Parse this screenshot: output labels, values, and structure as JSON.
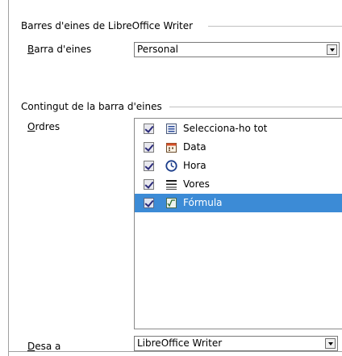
{
  "toolbars_section": {
    "title": "Barres d'eines de LibreOffice Writer",
    "toolbar_label_accel": "B",
    "toolbar_label_rest": "arra d'eines",
    "toolbar_value": "Personal"
  },
  "contents_section": {
    "title": "Contingut de la barra d'eines",
    "commands_label_accel": "O",
    "commands_label_rest": "rdres",
    "commands": [
      {
        "label": "Selecciona-ho tot",
        "icon": "select-all-icon",
        "checked": true
      },
      {
        "label": "Data",
        "icon": "calendar-date-icon",
        "checked": true
      },
      {
        "label": "Hora",
        "icon": "clock-icon",
        "checked": true
      },
      {
        "label": "Vores",
        "icon": "borders-icon",
        "checked": true
      },
      {
        "label": "Fórmula",
        "icon": "formula-icon",
        "checked": true,
        "selected": true
      }
    ],
    "selection_color": "#3c8bd6"
  },
  "save_in": {
    "label_accel": "D",
    "label_rest": "esa a",
    "value": "LibreOffice Writer"
  }
}
